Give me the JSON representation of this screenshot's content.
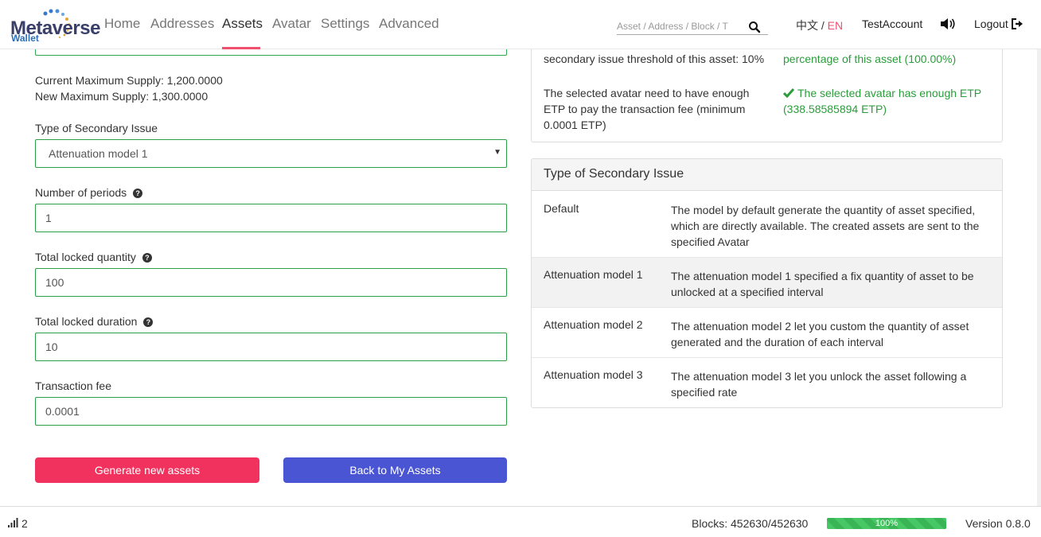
{
  "brand": {
    "name": "Metaverse",
    "sub": "Wallet"
  },
  "nav": {
    "items": [
      {
        "label": "Home",
        "active": false
      },
      {
        "label": "Addresses",
        "active": false
      },
      {
        "label": "Assets",
        "active": true
      },
      {
        "label": "Avatar",
        "active": false
      },
      {
        "label": "Settings",
        "active": false
      },
      {
        "label": "Advanced",
        "active": false
      }
    ],
    "search_placeholder": "Asset / Address / Block / T",
    "lang_zh": "中文",
    "lang_sep": " / ",
    "lang_en": "EN",
    "account": "TestAccount",
    "logout": "Logout"
  },
  "form": {
    "current_max_supply": "Current Maximum Supply: 1,200.0000",
    "new_max_supply": "New Maximum Supply: 1,300.0000",
    "type_label": "Type of Secondary Issue",
    "type_value": "Attenuation model 1",
    "periods_label": "Number of periods",
    "periods_value": "1",
    "locked_qty_label": "Total locked quantity",
    "locked_qty_value": "100",
    "locked_duration_label": "Total locked duration",
    "locked_duration_value": "10",
    "fee_label": "Transaction fee",
    "fee_value": "0.0001",
    "generate_button": "Generate new assets",
    "back_button": "Back to My Assets"
  },
  "checks": {
    "threshold_text": "secondary issue threshold of this asset: 10%",
    "threshold_result": "percentage of this asset (100.00%)",
    "etp_text_1": "The selected avatar need to have enough",
    "etp_text_2": "ETP to pay the transaction fee (minimum",
    "etp_text_3": "0.0001 ETP)",
    "etp_result_1": "The selected avatar has enough ETP",
    "etp_result_2": "(338.58585894 ETP)"
  },
  "models": {
    "title": "Type of Secondary Issue",
    "rows": [
      {
        "name": "Default",
        "desc": "The model by default generate the quantity of asset specified, which are directly available. The created assets are sent to the specified Avatar"
      },
      {
        "name": "Attenuation model 1",
        "desc": "The attenuation model 1 specified a fix quantity of asset to be unlocked at a specified interval"
      },
      {
        "name": "Attenuation model 2",
        "desc": "The attenuation model 2 let you custom the quantity of asset generated and the duration of each interval"
      },
      {
        "name": "Attenuation model 3",
        "desc": "The attenuation model 3 let you unlock the asset following a specified rate"
      }
    ]
  },
  "status": {
    "peers": "2",
    "blocks": "Blocks: 452630/452630",
    "progress_label": "100%",
    "progress_fraction": 1.0,
    "version": "Version 0.8.0"
  },
  "colors": {
    "accent": "#f0506e",
    "primary_button": "#f2325e",
    "secondary_button": "#4a55d4",
    "success": "#2a9d3a",
    "field_border": "#2e9e4a"
  }
}
